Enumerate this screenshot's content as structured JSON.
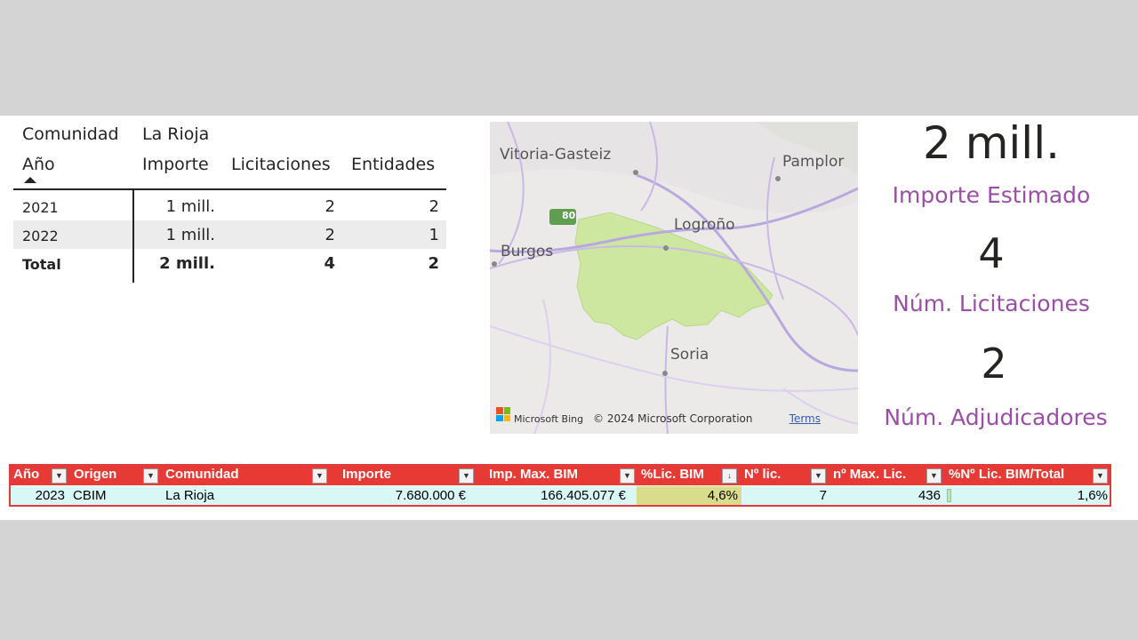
{
  "matrix": {
    "header": {
      "comunidad_label": "Comunidad",
      "comunidad_value": "La Rioja"
    },
    "columns": {
      "year": "Año",
      "importe": "Importe",
      "licitaciones": "Licitaciones",
      "entidades": "Entidades"
    },
    "rows": [
      {
        "year": "2021",
        "importe": "1 mill.",
        "licitaciones": "2",
        "entidades": "2"
      },
      {
        "year": "2022",
        "importe": "1 mill.",
        "licitaciones": "2",
        "entidades": "1"
      }
    ],
    "total": {
      "label": "Total",
      "importe": "2 mill.",
      "licitaciones": "4",
      "entidades": "2"
    }
  },
  "map": {
    "labels": {
      "vitoria": "Vitoria-Gasteiz",
      "pamplona": "Pamplor",
      "logrono": "Logroño",
      "burgos": "Burgos",
      "soria": "Soria",
      "road": "80"
    },
    "footer_brand": "Microsoft Bing",
    "copyright": "© 2024 Microsoft Corporation",
    "terms": "Terms",
    "region_color": "#cde6a0"
  },
  "kpis": [
    {
      "value": "2 mill.",
      "label": "Importe Estimado"
    },
    {
      "value": "4",
      "label": "Núm. Licitaciones"
    },
    {
      "value": "2",
      "label": "Núm. Adjudicadores"
    }
  ],
  "excel": {
    "headers": {
      "ano": "Año",
      "origen": "Origen",
      "comunidad": "Comunidad",
      "importe": "Importe",
      "imp_max": "Imp. Max. BIM",
      "pct_lic": "%Lic. BIM",
      "n_lic": "Nº lic.",
      "n_max": "nº Max. Lic.",
      "pct_total": "%Nº Lic. BIM/Total"
    },
    "row": {
      "ano": "2023",
      "origen": "CBIM",
      "comunidad": "La Rioja",
      "importe": "7.680.000 €",
      "imp_max": "166.405.077 €",
      "pct_lic": "4,6%",
      "n_lic": "7",
      "n_max": "436",
      "pct_total": "1,6%"
    },
    "header_color": "#e83a34"
  }
}
